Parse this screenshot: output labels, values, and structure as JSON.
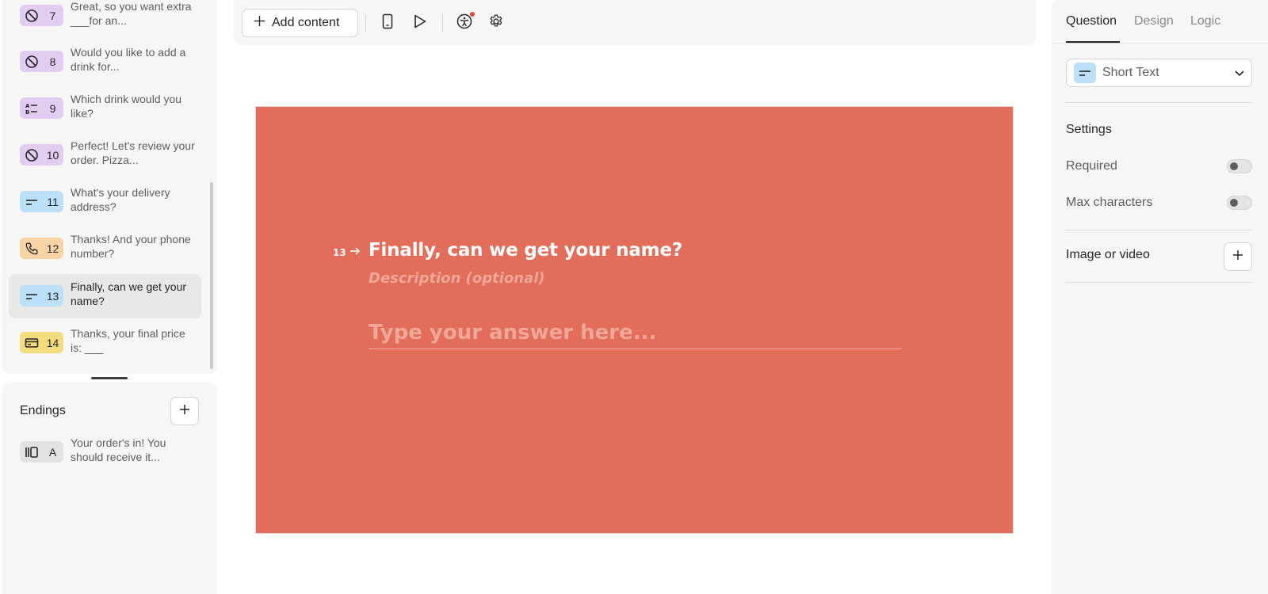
{
  "sidebar": {
    "questions": [
      {
        "number": "7",
        "text": "Great, so you want extra ___for an...",
        "type_icon": "no-entry-icon",
        "color": "purple"
      },
      {
        "number": "8",
        "text": "Would you like to add a drink for...",
        "type_icon": "no-entry-icon",
        "color": "purple"
      },
      {
        "number": "9",
        "text": "Which drink would you like?",
        "type_icon": "ab-list-icon",
        "color": "purple"
      },
      {
        "number": "10",
        "text": "Perfect! Let's review your order. Pizza...",
        "type_icon": "no-entry-icon",
        "color": "purple"
      },
      {
        "number": "11",
        "text": "What's your delivery address?",
        "type_icon": "short-text-icon",
        "color": "blue"
      },
      {
        "number": "12",
        "text": "Thanks! And your phone number?",
        "type_icon": "phone-icon",
        "color": "orange"
      },
      {
        "number": "13",
        "text": "Finally, can we get your name?",
        "type_icon": "short-text-icon",
        "color": "blue",
        "active": true
      },
      {
        "number": "14",
        "text": "Thanks, your final price is: ___",
        "type_icon": "credit-card-icon",
        "color": "yellow"
      }
    ],
    "endings_title": "Endings",
    "endings": [
      {
        "letter": "A",
        "text": "Your order's in! You should receive it..."
      }
    ]
  },
  "toolbar": {
    "add_content_label": "Add content"
  },
  "canvas": {
    "question_number": "13",
    "question_title": "Finally, can we get your name?",
    "description_placeholder": "Description (optional)",
    "answer_placeholder": "Type your answer here...",
    "background_color": "#e26d5a"
  },
  "right_panel": {
    "tabs": [
      "Question",
      "Design",
      "Logic"
    ],
    "active_tab": "Question",
    "question_type": "Short Text",
    "settings_title": "Settings",
    "required_label": "Required",
    "required_on": false,
    "max_chars_label": "Max characters",
    "max_chars_on": false,
    "image_label": "Image or video"
  }
}
